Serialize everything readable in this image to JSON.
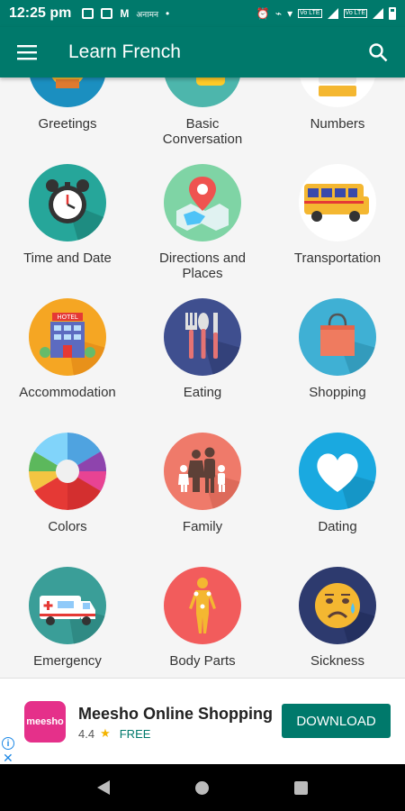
{
  "status_bar": {
    "time": "12:25 pm",
    "carrier_label": "अनामन",
    "lte1": "Vo LTE",
    "lte2": "Vo LTE"
  },
  "app_bar": {
    "title": "Learn French",
    "menu_icon": "hamburger-menu-icon",
    "search_icon": "search-icon"
  },
  "categories": [
    {
      "label": "Greetings",
      "icon": "greetings-icon"
    },
    {
      "label": "Basic\nConversation",
      "icon": "conversation-icon"
    },
    {
      "label": "Numbers",
      "icon": "numbers-icon"
    },
    {
      "label": "Time and Date",
      "icon": "alarm-clock-icon"
    },
    {
      "label": "Directions and\nPlaces",
      "icon": "map-pin-icon"
    },
    {
      "label": "Transportation",
      "icon": "school-bus-icon"
    },
    {
      "label": "Accommodation",
      "icon": "hotel-icon"
    },
    {
      "label": "Eating",
      "icon": "cutlery-icon"
    },
    {
      "label": "Shopping",
      "icon": "shopping-bag-icon"
    },
    {
      "label": "Colors",
      "icon": "color-wheel-icon"
    },
    {
      "label": "Family",
      "icon": "family-icon"
    },
    {
      "label": "Dating",
      "icon": "heart-icon"
    },
    {
      "label": "Emergency",
      "icon": "ambulance-icon"
    },
    {
      "label": "Body Parts",
      "icon": "human-body-icon"
    },
    {
      "label": "Sickness",
      "icon": "sick-face-icon"
    }
  ],
  "ad": {
    "logo_text": "meesho",
    "title": "Meesho Online Shopping",
    "rating": "4.4",
    "price": "FREE",
    "button": "DOWNLOAD"
  },
  "colors": {
    "primary": "#00796b",
    "ad_logo": "#e5308a"
  }
}
